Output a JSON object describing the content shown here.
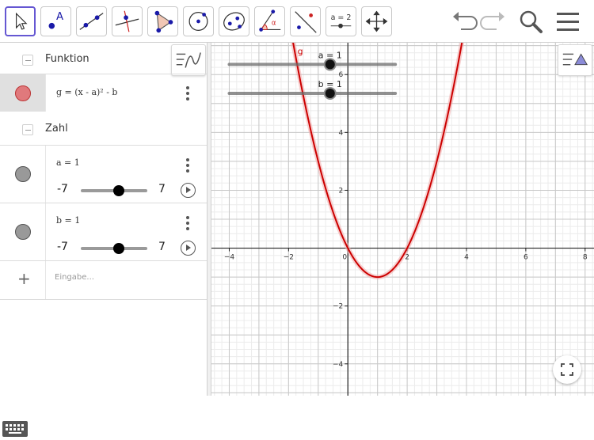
{
  "toolbar": {
    "tools": [
      {
        "name": "move-tool",
        "icon": "cursor-arrow-icon",
        "active": true
      },
      {
        "name": "point-tool",
        "icon": "point-icon",
        "label": "A"
      },
      {
        "name": "line-tool",
        "icon": "line-through-points-icon"
      },
      {
        "name": "perpendicular-tool",
        "icon": "perpendicular-line-icon"
      },
      {
        "name": "polygon-tool",
        "icon": "polygon-icon"
      },
      {
        "name": "circle-tool",
        "icon": "circle-center-point-icon"
      },
      {
        "name": "conic-tool",
        "icon": "ellipse-icon"
      },
      {
        "name": "angle-tool",
        "icon": "angle-icon",
        "label": "α"
      },
      {
        "name": "reflect-tool",
        "icon": "reflect-icon"
      },
      {
        "name": "slider-tool",
        "icon": "slider-icon",
        "label": "a = 2"
      },
      {
        "name": "move-graphics-tool",
        "icon": "move-view-icon"
      }
    ],
    "actions": [
      "undo-icon",
      "redo-icon",
      "search-icon",
      "menu-icon"
    ]
  },
  "algebra": {
    "groups": [
      {
        "label": "Funktion"
      },
      {
        "label": "Zahl"
      }
    ],
    "function_item": {
      "definition": "g = (x - a)² - b",
      "color": "#d64545"
    },
    "sliders": [
      {
        "definition": "a = 1",
        "min": "-7",
        "max": "7",
        "value": 1,
        "range": [
          -7,
          7
        ]
      },
      {
        "definition": "b = 1",
        "min": "-7",
        "max": "7",
        "value": 1,
        "range": [
          -7,
          7
        ]
      }
    ],
    "input_placeholder": "Eingabe..."
  },
  "graphics": {
    "function_label": "g",
    "curve_color": "#cc0000",
    "x_range": [
      -4.6,
      8.3
    ],
    "y_range": [
      -5.1,
      7.1
    ],
    "x_ticks": [
      "−4",
      "−2",
      "0",
      "2",
      "4",
      "6",
      "8"
    ],
    "y_ticks": [
      "−4",
      "−2",
      "2",
      "4",
      "6"
    ],
    "slider_a_label": "a = 1",
    "slider_b_label": "b = 1"
  }
}
